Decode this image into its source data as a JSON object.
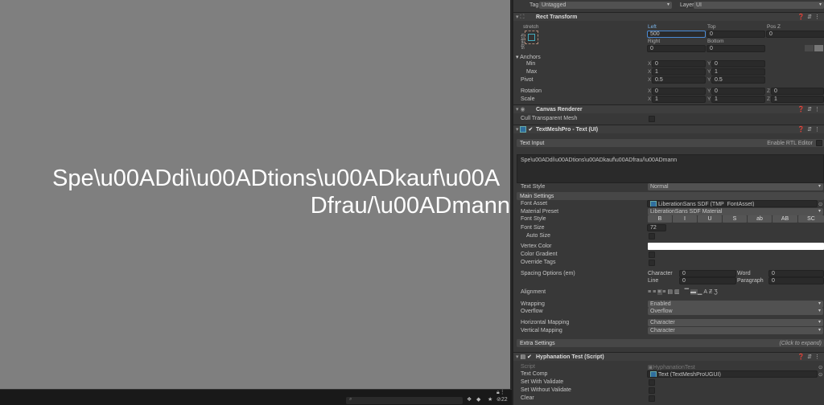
{
  "scene": {
    "line1": "Spe\\u00ADdi\\u00ADtions\\u00ADkauf\\u00A",
    "line2": "Dfrau/\\u00ADmann"
  },
  "bottombar": {
    "layers_count": "22"
  },
  "header": {
    "tag_label": "Tag",
    "tag_value": "Untagged",
    "layer_label": "Layer",
    "layer_value": "UI"
  },
  "rect_transform": {
    "title": "Rect Transform",
    "stretch_h": "stretch",
    "stretch_v": "stretch",
    "left_label": "Left",
    "left": "500",
    "top_label": "Top",
    "top": "0",
    "posz_label": "Pos Z",
    "posz": "0",
    "right_label": "Right",
    "right": "0",
    "bottom_label": "Bottom",
    "bottom": "0",
    "anchors_label": "Anchors",
    "min_label": "Min",
    "min_x": "0",
    "min_y": "0",
    "max_label": "Max",
    "max_x": "1",
    "max_y": "1",
    "pivot_label": "Pivot",
    "pivot_x": "0.5",
    "pivot_y": "0.5",
    "rotation_label": "Rotation",
    "rot_x": "0",
    "rot_y": "0",
    "rot_z": "0",
    "scale_label": "Scale",
    "scale_x": "1",
    "scale_y": "1",
    "scale_z": "1"
  },
  "canvas_renderer": {
    "title": "Canvas Renderer",
    "cull_label": "Cull Transparent Mesh"
  },
  "tmp": {
    "title": "TextMeshPro - Text (UI)",
    "text_input_label": "Text Input",
    "rtl_label": "Enable RTL Editor",
    "text": "Spe\\u00ADdi\\u00ADtions\\u00ADkauf\\u00ADfrau/\\u00ADmann",
    "text_style_label": "Text Style",
    "text_style": "Normal",
    "main_settings": "Main Settings",
    "font_asset_label": "Font Asset",
    "font_asset": "LiberationSans SDF (TMP_FontAsset)",
    "material_preset_label": "Material Preset",
    "material_preset": "LiberationSans SDF Material",
    "font_style_label": "Font Style",
    "font_style_buttons": [
      "B",
      "I",
      "U",
      "S",
      "ab",
      "AB",
      "SC"
    ],
    "font_size_label": "Font Size",
    "font_size": "72",
    "auto_size_label": "Auto Size",
    "vertex_color_label": "Vertex Color",
    "vertex_color": "#ffffff",
    "color_gradient_label": "Color Gradient",
    "override_tags_label": "Override Tags",
    "spacing_label": "Spacing Options (em)",
    "character_label": "Character",
    "character": "0",
    "word_label": "Word",
    "word": "0",
    "line_label": "Line",
    "line": "0",
    "paragraph_label": "Paragraph",
    "paragraph": "0",
    "alignment_label": "Alignment",
    "wrapping_label": "Wrapping",
    "wrapping": "Enabled",
    "overflow_label": "Overflow",
    "overflow": "Overflow",
    "hmap_label": "Horizontal Mapping",
    "hmap": "Character",
    "vmap_label": "Vertical Mapping",
    "vmap": "Character",
    "extra_settings": "Extra Settings",
    "click_expand": "(Click to expand)"
  },
  "script": {
    "title": "Hyphanation Test (Script)",
    "script_label": "Script",
    "script_value": "HyphanationTest",
    "text_comp_label": "Text Comp",
    "text_comp": "Text (TextMeshProUGUI)",
    "set_with_label": "Set With Validate",
    "set_without_label": "Set Without Validate",
    "clear_label": "Clear"
  }
}
